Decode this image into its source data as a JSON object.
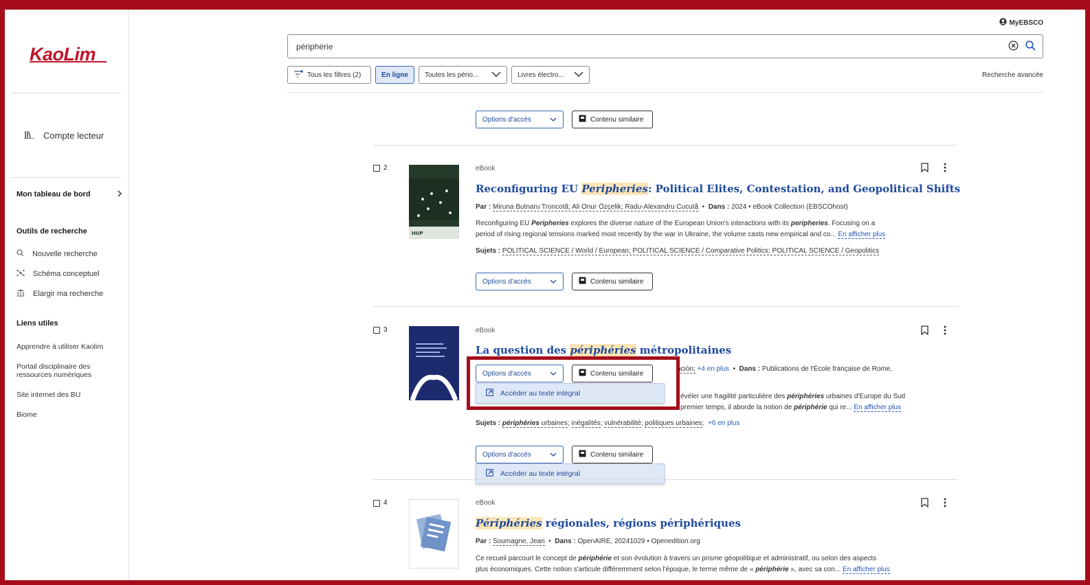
{
  "header": {
    "account_label": "MyEBSCO",
    "search_value": "périphérie",
    "advanced_label": "Recherche avancée",
    "filters": [
      {
        "label": "Tous les filtres (2)"
      },
      {
        "label": "En ligne"
      },
      {
        "label": "Toutes les pério..."
      },
      {
        "label": "Livres électro..."
      }
    ]
  },
  "sidebar": {
    "logo": "KaoLim",
    "account": "Compte lecteur",
    "dashboard": "Mon tableau de bord",
    "tools_heading": "Outils de recherche",
    "tools": [
      "Nouvelle recherche",
      "Schéma conceptuel",
      "Elargir ma recherche"
    ],
    "links_heading": "Liens utiles",
    "links": [
      "Apprendre à utiliser Kaolim",
      "Portail disciplinaire des ressources numériques",
      "Site internet des BU",
      "Biome"
    ]
  },
  "buttons": {
    "access": "Options d'accès",
    "similar": "Contenu similaire",
    "fulltext": "Accéder au texte intégral"
  },
  "results": [
    {
      "num": "2",
      "type": "eBook",
      "title_pre": "Reconfiguring EU ",
      "title_hl": "Peripheries",
      "title_post": ": Political Elites, Contestation, and Geopolitical Shifts",
      "by_label": "Par :",
      "authors": "Miruna Butnaru Troncotă; Ali Onur Özçelik; Radu-Alexandru Cucută",
      "in_label": "Dans :",
      "source": "2024 • eBook Collection (EBSCOhost)",
      "abstract_line1_a": "Reconfiguring EU ",
      "abstract_line1_b": "Peripheries",
      "abstract_line1_c": " explores the diverse nature of the European Union's interactions with its ",
      "abstract_line1_d": "peripheries",
      "abstract_line1_e": ". Focusing on a",
      "abstract_line2": "period of rising regional tensions marked most recently by the war in Ukraine, the volume casts new empirical and co...",
      "more": "En afficher plus",
      "subjects_label": "Sujets :",
      "subjects": "POLITICAL SCIENCE / World / European; POLITICAL SCIENCE / Comparative Politics; POLITICAL SCIENCE / Geopolitics",
      "cover_title": "Reconfiguring EU Peripheries"
    },
    {
      "num": "3",
      "type": "eBook",
      "title_pre": "La question des ",
      "title_hl": "périphéries",
      "title_post": " métropolitaines",
      "authors_tail": "nción;",
      "authors_more": "+4 en plus",
      "in_label": "Dans :",
      "source": "Publications de l'École française de Rome,",
      "abstract_line1_a": "évéler une fragilité particulière des ",
      "abstract_line1_b": "périphéries",
      "abstract_line1_c": " urbaines d'Europe du Sud",
      "abstract_line2_a": "premier temps, il aborde la notion de ",
      "abstract_line2_b": "périphérie",
      "abstract_line2_c": " qui re...",
      "more": "En afficher plus",
      "subjects_label": "Sujets :",
      "subject1": "périphéries",
      "subject1_tail": " urbaines",
      "subject2": "inégalités",
      "subject3": "vulnérabilité",
      "subject4": "politiques urbaines",
      "subjects_more": "+6 en plus"
    },
    {
      "num": "4",
      "type": "eBook",
      "title_hl": "Périphéries",
      "title_post": " régionales, régions périphériques",
      "by_label": "Par :",
      "authors": "Soumagne, Jean",
      "in_label": "Dans :",
      "source": "OpenAIRE, 20241029 • Openedition.org",
      "abstract_line1_a": "Ce recueil parcourt le concept de ",
      "abstract_line1_b": "périphérie",
      "abstract_line1_c": " et son évolution à travers un prisme géopolitique et administratif, ou selon des aspects",
      "abstract_line2_a": "plus économiques. Cette notion s'articule différemment selon l'époque, le terme même de « ",
      "abstract_line2_b": "périphérie",
      "abstract_line2_c": " », avec sa con...",
      "more": "En afficher plus"
    }
  ],
  "colors": {
    "brand": "#c0152a",
    "link": "#1f4aa0",
    "highlight": "#fde6b6",
    "frame": "#a50d1a"
  }
}
